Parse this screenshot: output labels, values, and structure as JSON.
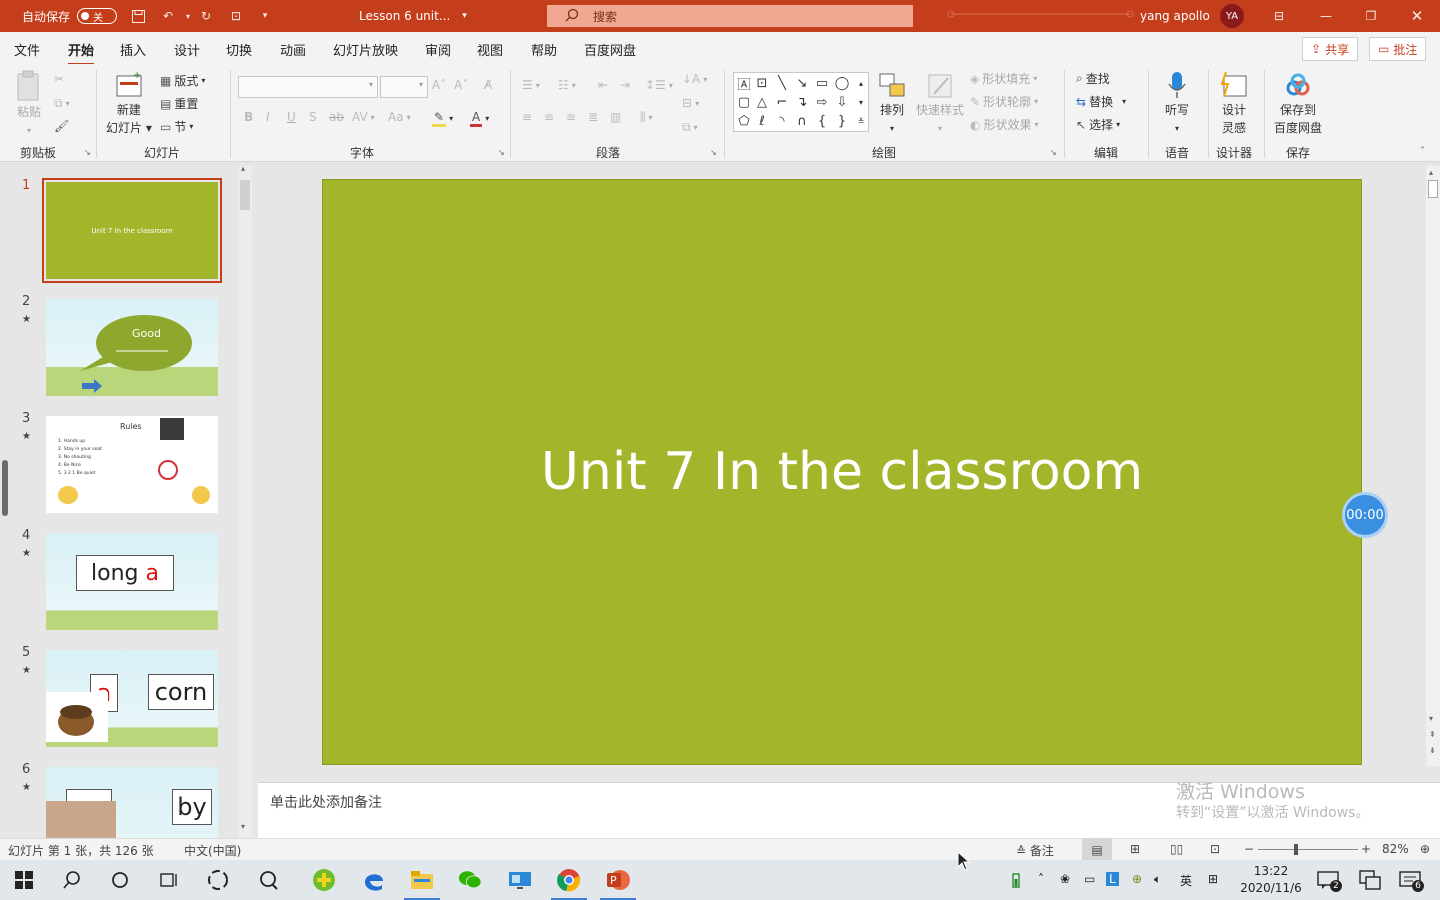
{
  "titlebar": {
    "autosave_label": "自动保存",
    "autosave_state": "关",
    "doc_title": "Lesson 6 unit...",
    "search_placeholder": "搜索",
    "user_name": "yang apollo",
    "avatar_initials": "YA"
  },
  "menu": {
    "tabs": [
      "文件",
      "开始",
      "插入",
      "设计",
      "切换",
      "动画",
      "幻灯片放映",
      "审阅",
      "视图",
      "帮助",
      "百度网盘"
    ],
    "active_tab": "开始",
    "share_label": "共享",
    "comment_label": "批注"
  },
  "ribbon": {
    "clipboard": {
      "paste_label": "粘贴",
      "group_label": "剪贴板"
    },
    "slides": {
      "new_slide_line1": "新建",
      "new_slide_line2": "幻灯片",
      "layout_label": "版式",
      "reset_label": "重置",
      "section_label": "节",
      "group_label": "幻灯片"
    },
    "font": {
      "group_label": "字体"
    },
    "paragraph": {
      "group_label": "段落"
    },
    "drawing": {
      "arrange_label": "排列",
      "quick_styles_label": "快速样式",
      "shape_fill_label": "形状填充",
      "shape_outline_label": "形状轮廓",
      "shape_effects_label": "形状效果",
      "group_label": "绘图"
    },
    "editing": {
      "find_label": "查找",
      "replace_label": "替换",
      "select_label": "选择",
      "group_label": "编辑"
    },
    "voice": {
      "dictate_label": "听写",
      "group_label": "语音"
    },
    "designer": {
      "design_ideas_line1": "设计",
      "design_ideas_line2": "灵感",
      "group_label": "设计器"
    },
    "save": {
      "save_baidu_line1": "保存到",
      "save_baidu_line2": "百度网盘",
      "group_label": "保存"
    }
  },
  "thumbnails": [
    {
      "num": "1",
      "text": "Unit 7 In the classroom"
    },
    {
      "num": "2",
      "text": "Good"
    },
    {
      "num": "3",
      "title": "Rules",
      "rules": [
        "1. Hands up",
        "2. Stay in your seat",
        "3. No shouting",
        "4. Be Nice",
        "5. 3 2 1 Be quiet"
      ]
    },
    {
      "num": "4",
      "word_plain": "long ",
      "word_red": "a"
    },
    {
      "num": "5",
      "letter_red": "a",
      "word": "corn"
    },
    {
      "num": "6",
      "word": "by"
    }
  ],
  "slide": {
    "title": "Unit 7 In the classroom",
    "bg_color": "#a3b52a",
    "timer": "00:00"
  },
  "notes": {
    "placeholder": "单击此处添加备注",
    "watermark_line1": "激活 Windows",
    "watermark_line2": "转到“设置”以激活 Windows。"
  },
  "statusbar": {
    "slide_counter": "幻灯片 第 1 张，共 126 张",
    "language": "中文(中国)",
    "notes_label": "备注",
    "zoom": "82%"
  },
  "taskbar": {
    "ime": "英",
    "time": "13:22",
    "date": "2020/11/6",
    "notif_count": "2",
    "action_count": "6"
  },
  "colors": {
    "accent": "#c43e1c",
    "slide_green": "#a3b52a",
    "timer_blue": "#3b8fe0"
  }
}
